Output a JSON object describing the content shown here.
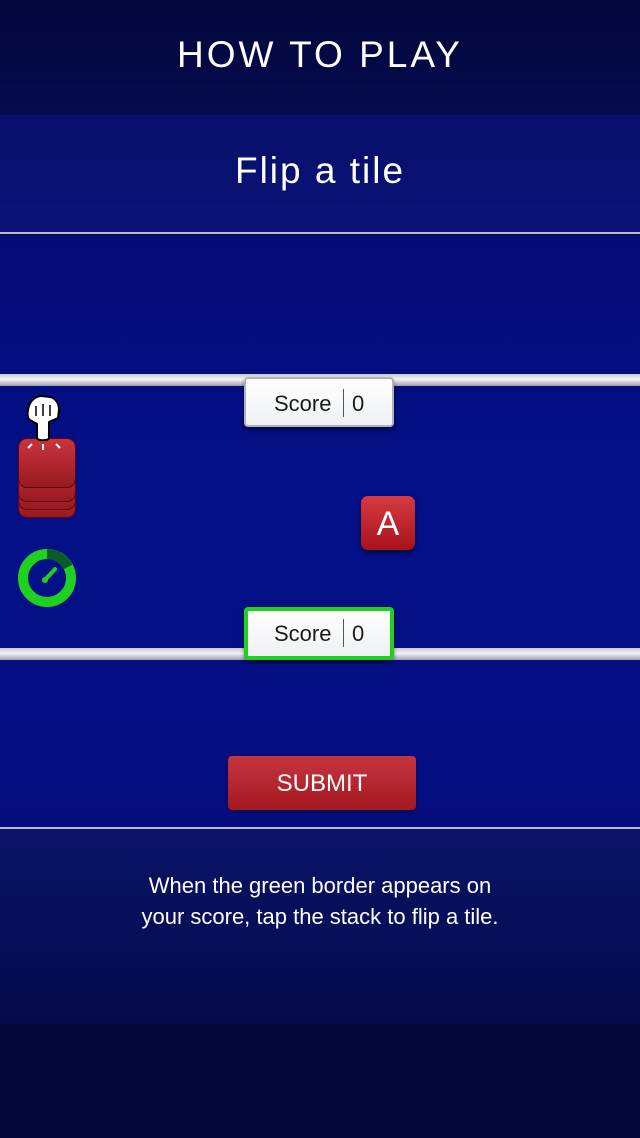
{
  "header": {
    "title": "HOW TO PLAY"
  },
  "step": {
    "title": "Flip a tile"
  },
  "opponent_score": {
    "label": "Score",
    "value": "0"
  },
  "player_score": {
    "label": "Score",
    "value": "0",
    "active_border_color": "#1fd11f"
  },
  "tile": {
    "letter": "A"
  },
  "submit": {
    "label": "SUBMIT"
  },
  "instructions": {
    "line1": "When the green border appears on",
    "line2": "your score, tap the stack to flip a tile."
  },
  "icons": [
    "pointing-hand-icon",
    "tile-stack-icon",
    "timer-icon"
  ],
  "colors": {
    "background": "#050a4a",
    "tile": "#c0262e",
    "accent": "#1fd11f"
  }
}
